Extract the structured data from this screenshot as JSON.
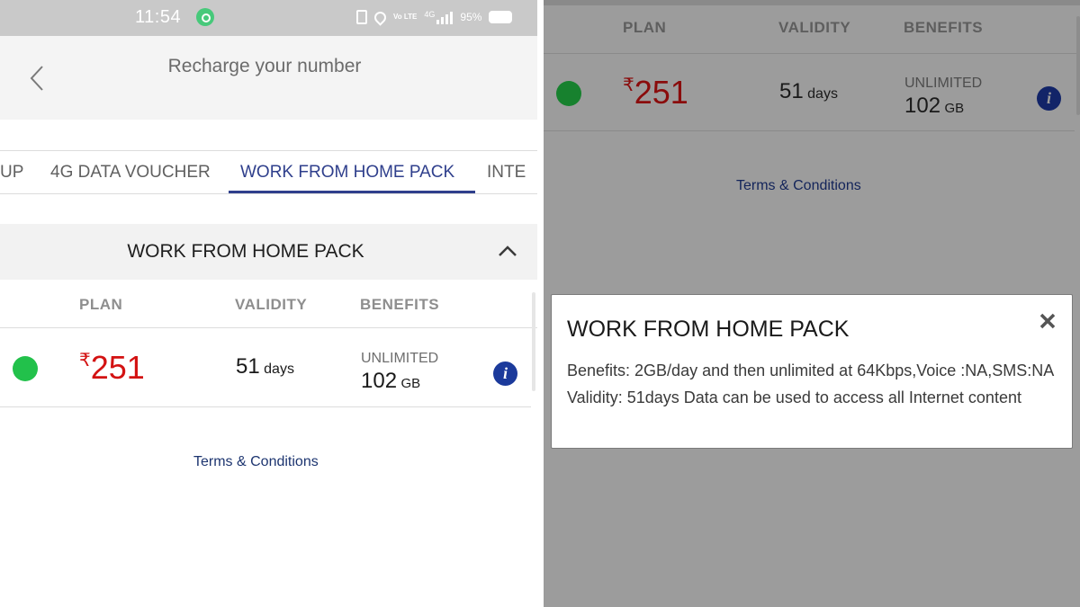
{
  "status_bar": {
    "time": "11:54",
    "volte": "Vo LTE",
    "network": "4G",
    "battery_percent": "95%",
    "icons": [
      "app-notification-icon",
      "vibrate-icon",
      "location-icon",
      "volte-icon",
      "signal-icon",
      "battery-icon"
    ]
  },
  "header": {
    "title": "Recharge your number",
    "back_icon": "back-arrow-icon"
  },
  "tabs": [
    {
      "label": "UP",
      "active": false
    },
    {
      "label": "4G DATA VOUCHER",
      "active": false
    },
    {
      "label": "WORK FROM HOME PACK",
      "active": true
    },
    {
      "label": "INTE",
      "active": false
    }
  ],
  "section": {
    "title": "WORK FROM HOME PACK",
    "toggle_icon": "chevron-up-icon"
  },
  "table": {
    "columns": [
      "PLAN",
      "VALIDITY",
      "BENEFITS"
    ],
    "row": {
      "status_color": "#22c14b",
      "currency": "₹",
      "price": "251",
      "validity_value": "51",
      "validity_unit": "days",
      "benefit_label": "UNLIMITED",
      "benefit_value": "102",
      "benefit_unit": "GB",
      "info_icon": "i"
    }
  },
  "terms_link": "Terms & Conditions",
  "modal": {
    "title": "WORK FROM HOME PACK",
    "close_icon": "close-icon",
    "body": "Benefits: 2GB/day and then unlimited at 64Kbps,Voice :NA,SMS:NA Validity: 51days Data can be used to access all Internet content"
  },
  "colors": {
    "accent": "#2f3f8c",
    "price": "#d31212",
    "active_dot": "#22c14b",
    "info": "#1b3a9b",
    "terms": "#1d3570",
    "overlay": "#9c9c9c"
  }
}
